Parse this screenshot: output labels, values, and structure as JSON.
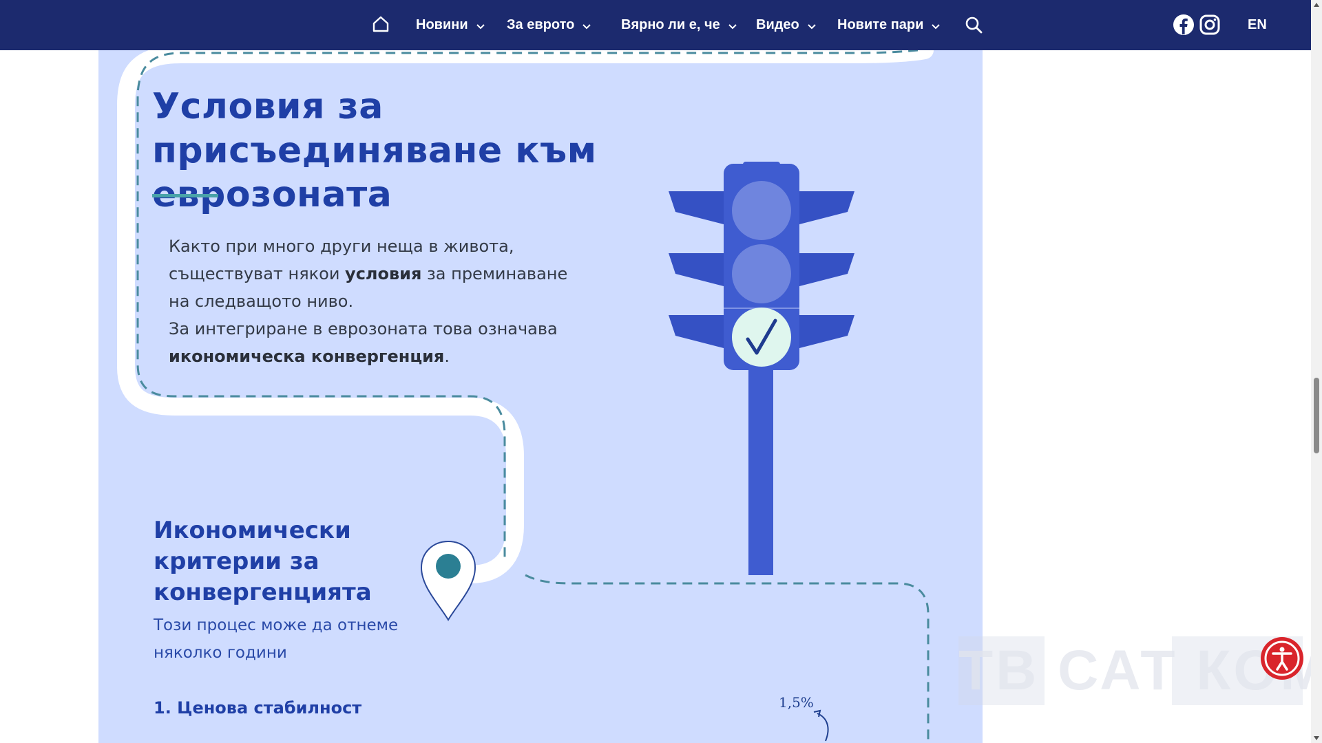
{
  "nav": {
    "items": [
      {
        "label": "Новини"
      },
      {
        "label": "За еврото"
      },
      {
        "label": "Вярно ли е, че"
      },
      {
        "label": "Видео"
      },
      {
        "label": "Новите пари"
      }
    ],
    "lang": "EN",
    "icons": [
      "home-icon",
      "chevron-down-icon",
      "search-icon",
      "facebook-icon",
      "instagram-icon"
    ]
  },
  "infographic": {
    "title": "Условия за присъединяване към еврозоната",
    "intro": {
      "p1": "Както при много други неща в живота,",
      "p2a": "съществуват някои ",
      "p2b": "условия",
      "p2c": " за преминаване",
      "p3": "на следващото ниво.",
      "p4": "За интегриране в еврозоната това означава",
      "p5a": "икономическа конвергенция",
      "p5b": "."
    },
    "criteria_title": "Икономически критерии за конвергенцията",
    "criteria_subtitle": "Този процес може да отнеме няколко години",
    "first_criterion": "1. Ценова стабилност",
    "percent": "1,5%",
    "icons": [
      "traffic-light-icon",
      "check-icon",
      "location-pin-icon"
    ]
  },
  "watermark": "ТВ САТ КОМ",
  "colors": {
    "nav_bg": "#1c2a6e",
    "panel_bg": "#cfdcff",
    "title": "#1f3fa6",
    "accent_teal": "#4aa3a9",
    "traffic_light": "#3f5cd0",
    "a11y_red": "#d9252c"
  }
}
